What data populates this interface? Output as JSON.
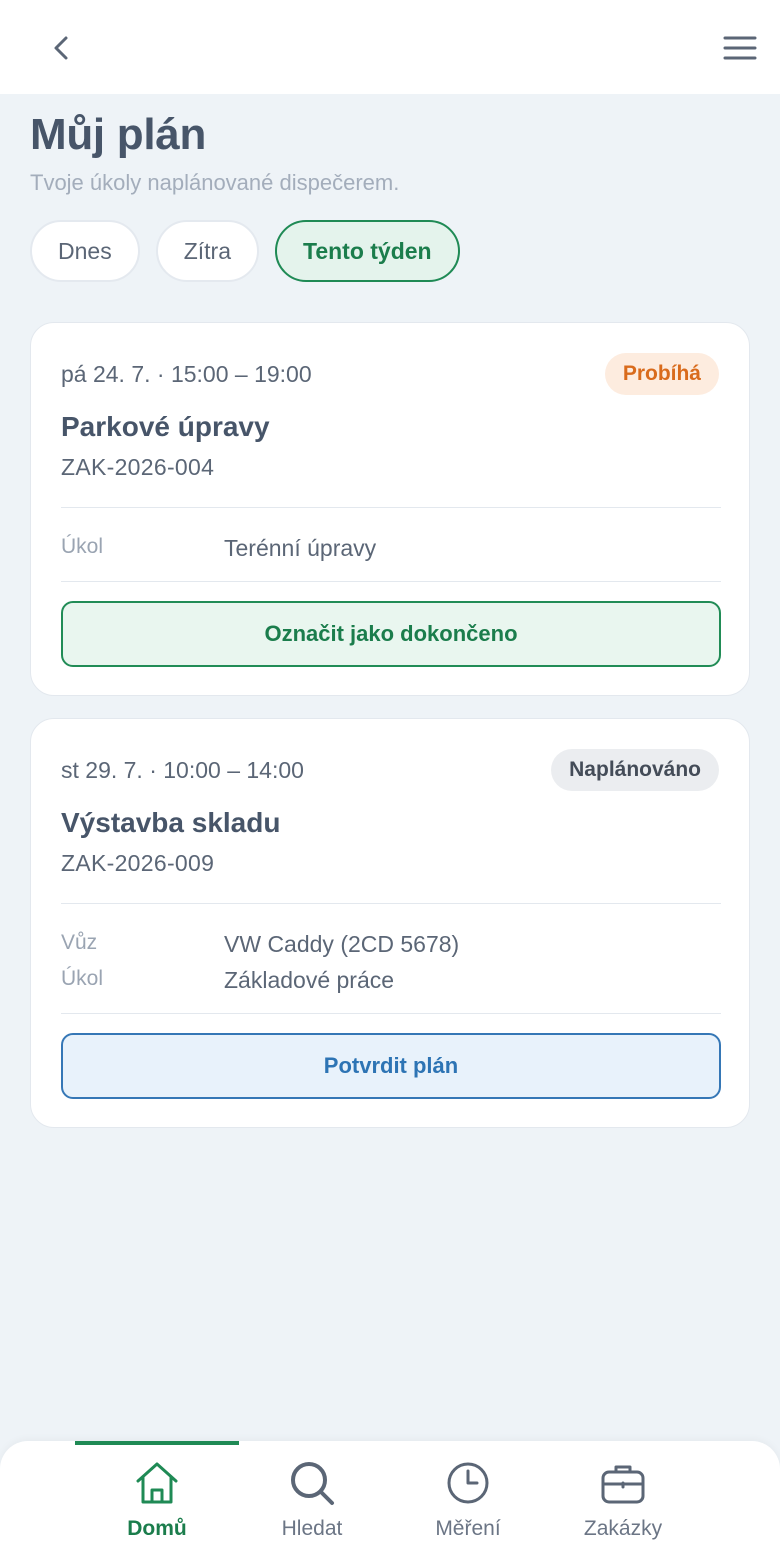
{
  "header": {
    "back_icon": "chevron-left-icon",
    "menu_icon": "hamburger-menu-icon"
  },
  "page": {
    "title": "Můj plán",
    "subtitle": "Tvoje úkoly naplánované dispečerem."
  },
  "filters": [
    {
      "label": "Dnes",
      "active": false
    },
    {
      "label": "Zítra",
      "active": false
    },
    {
      "label": "Tento týden",
      "active": true
    }
  ],
  "tasks": [
    {
      "time": "pá 24. 7. · 15:00 – 19:00",
      "status": "Probíhá",
      "title": "Parkové úpravy",
      "code": "ZAK-2026-004",
      "details": [
        {
          "key": "Úkol",
          "value": "Terénní úpravy"
        }
      ],
      "action": "Označit jako dokončeno"
    },
    {
      "time": "st 29. 7. · 10:00 – 14:00",
      "status": "Naplánováno",
      "title": "Výstavba skladu",
      "code": "ZAK-2026-009",
      "details": [
        {
          "key": "Vůz",
          "value": "VW Caddy (2CD 5678)"
        },
        {
          "key": "Úkol",
          "value": "Základové práce"
        }
      ],
      "action": "Potvrdit plán"
    }
  ],
  "nav": [
    {
      "label": "Domů",
      "icon": "home-icon",
      "active": true
    },
    {
      "label": "Hledat",
      "icon": "search-icon",
      "active": false
    },
    {
      "label": "Měření",
      "icon": "clock-icon",
      "active": false
    },
    {
      "label": "Zakázky",
      "icon": "briefcase-icon",
      "active": false
    }
  ],
  "colors": {
    "accent_green": "#1f8a55",
    "accent_blue": "#3577b6",
    "status_running": "#d96b1c",
    "background": "#eef3f7"
  }
}
